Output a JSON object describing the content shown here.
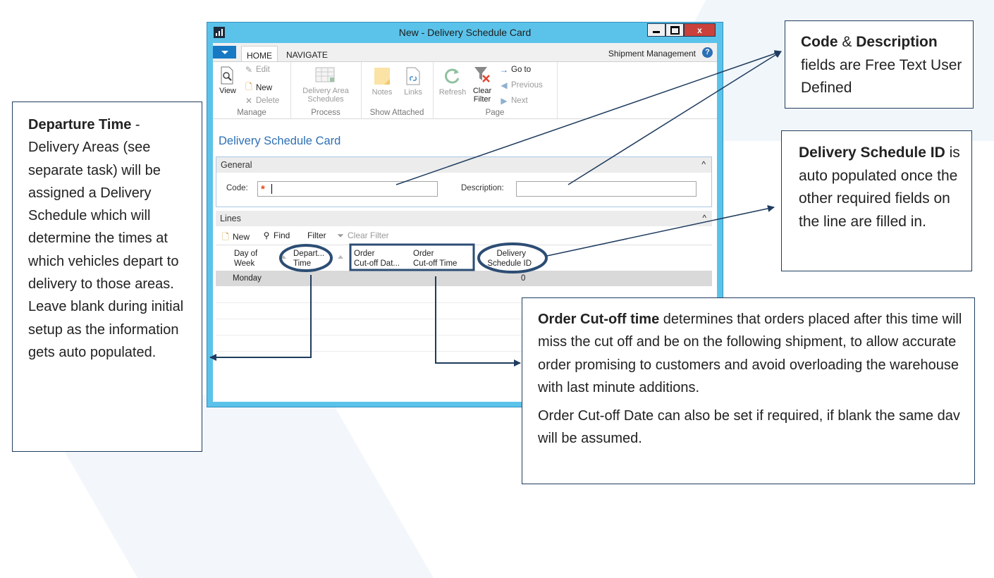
{
  "window": {
    "title": "New - Delivery Schedule Card",
    "close_glyph": "x"
  },
  "tabs": {
    "home": "HOME",
    "navigate": "NAVIGATE",
    "right_label": "Shipment Management",
    "help_glyph": "?"
  },
  "ribbon": {
    "manage": {
      "view": "View",
      "edit": "Edit",
      "new": "New",
      "delete": "Delete",
      "group": "Manage"
    },
    "process": {
      "delivery_area_schedules_1": "Delivery Area",
      "delivery_area_schedules_2": "Schedules",
      "group": "Process"
    },
    "show_attached": {
      "notes": "Notes",
      "links": "Links",
      "group": "Show Attached"
    },
    "page": {
      "refresh": "Refresh",
      "clear_filter_1": "Clear",
      "clear_filter_2": "Filter",
      "go_to": "Go to",
      "previous": "Previous",
      "next": "Next",
      "group": "Page"
    }
  },
  "card": {
    "title": "Delivery Schedule Card",
    "general": {
      "header": "General",
      "code_label": "Code:",
      "required_mark": "*",
      "description_label": "Description:",
      "collapse": "^"
    },
    "lines": {
      "header": "Lines",
      "collapse": "^",
      "toolbar": {
        "new": "New",
        "find": "Find",
        "filter": "Filter",
        "clear_filter": "Clear Filter"
      },
      "columns": [
        {
          "line1": "Day of",
          "line2": "Week"
        },
        {
          "line1": "Depart...",
          "line2": "Time"
        },
        {
          "line1": "Order",
          "line2": "Cut-off Dat..."
        },
        {
          "line1": "Order",
          "line2": "Cut-off Time"
        },
        {
          "line1": "Delivery",
          "line2": "Schedule ID"
        }
      ],
      "rows": [
        {
          "day": "Monday",
          "schedule_id": "0"
        }
      ]
    }
  },
  "annotations": {
    "departure": {
      "bold": "Departure Time",
      "text": " - Delivery Areas (see separate task) will be assigned a Delivery Schedule which will determine the times at which vehicles depart to delivery to those areas. Leave blank during initial setup as the information gets auto populated."
    },
    "code_desc": {
      "bold1": "Code",
      "mid": " & ",
      "bold2": "Description",
      "text": " fields are Free Text User Defined"
    },
    "schedule_id": {
      "bold": "Delivery Schedule ID",
      "text": " is auto populated once the other required fields on the line are filled in."
    },
    "cutoff": {
      "bold": "Order Cut-off time",
      "text": " determines that orders placed after this time will miss the cut off and be on the following shipment, to allow accurate order promising to customers and avoid overloading the warehouse with last minute additions.",
      "text2": "Order Cut-off Date can also be set if required, if blank the same dav will be assumed."
    }
  },
  "colors": {
    "window_frame": "#5bc3ea",
    "accent_blue": "#2d6fb5",
    "annotation_line": "#1f3c5e",
    "close_red": "#c9413a"
  }
}
